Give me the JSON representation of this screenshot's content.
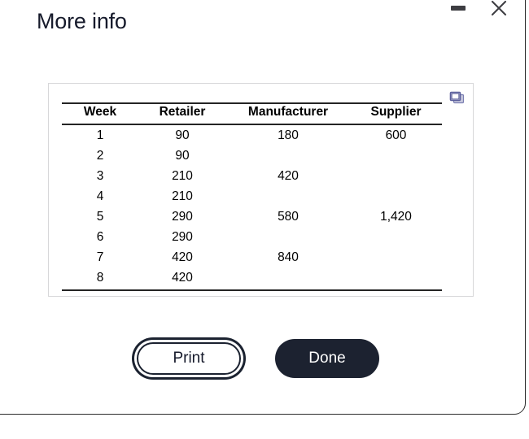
{
  "window": {
    "minimize_label": "Minimize",
    "close_label": "Close",
    "minimize_icon": "minimize-icon",
    "close_icon": "close-icon"
  },
  "header": {
    "title": "More info"
  },
  "panel": {
    "icon_name": "duplicate-windows-icon",
    "icon_color": "#6b6fa8"
  },
  "table": {
    "columns": [
      "Week",
      "Retailer",
      "Manufacturer",
      "Supplier"
    ],
    "rows": [
      {
        "week": "1",
        "retailer": "90",
        "manufacturer": "180",
        "supplier": "600"
      },
      {
        "week": "2",
        "retailer": "90",
        "manufacturer": "",
        "supplier": ""
      },
      {
        "week": "3",
        "retailer": "210",
        "manufacturer": "420",
        "supplier": ""
      },
      {
        "week": "4",
        "retailer": "210",
        "manufacturer": "",
        "supplier": ""
      },
      {
        "week": "5",
        "retailer": "290",
        "manufacturer": "580",
        "supplier": "1,420"
      },
      {
        "week": "6",
        "retailer": "290",
        "manufacturer": "",
        "supplier": ""
      },
      {
        "week": "7",
        "retailer": "420",
        "manufacturer": "840",
        "supplier": ""
      },
      {
        "week": "8",
        "retailer": "420",
        "manufacturer": "",
        "supplier": ""
      }
    ]
  },
  "footer": {
    "print_label": "Print",
    "done_label": "Done"
  },
  "colors": {
    "dark": "#1c2230",
    "title": "#161a2b",
    "panel_border": "#d7d7d9",
    "rule": "#242424"
  }
}
